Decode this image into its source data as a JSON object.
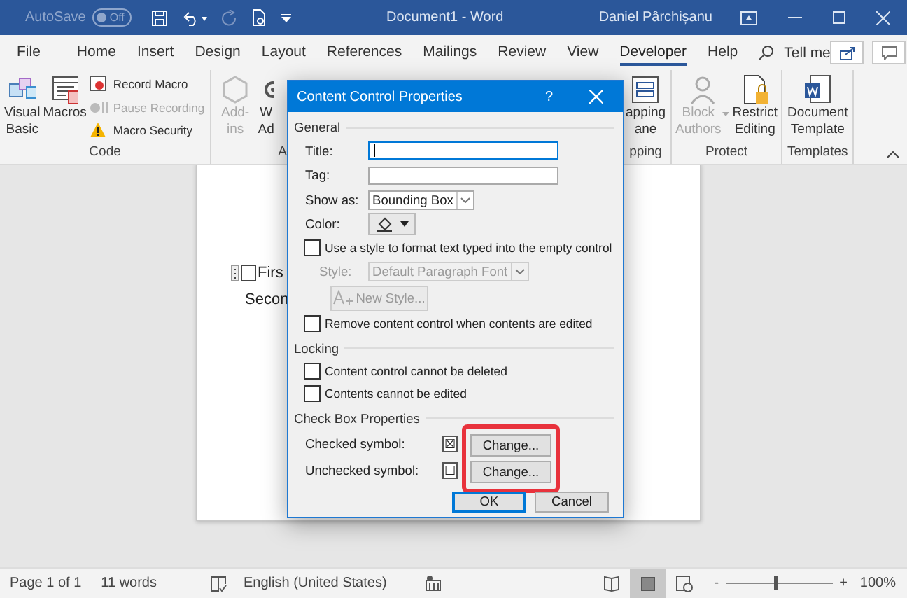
{
  "title_bar": {
    "autosave_label": "AutoSave",
    "autosave_state": "Off",
    "autosave_on": false,
    "document_title": "Document1  -  Word",
    "user_name": "Daniel Pârchișanu"
  },
  "tabs": [
    {
      "label": "File",
      "selected": false
    },
    {
      "label": "Home",
      "selected": false
    },
    {
      "label": "Insert",
      "selected": false
    },
    {
      "label": "Design",
      "selected": false
    },
    {
      "label": "Layout",
      "selected": false
    },
    {
      "label": "References",
      "selected": false
    },
    {
      "label": "Mailings",
      "selected": false
    },
    {
      "label": "Review",
      "selected": false
    },
    {
      "label": "View",
      "selected": false
    },
    {
      "label": "Developer",
      "selected": true
    },
    {
      "label": "Help",
      "selected": false
    }
  ],
  "tell_me": "Tell me",
  "ribbon": {
    "left_groups": [
      {
        "label": "Code",
        "items": [
          {
            "kind": "large",
            "label": "Visual Basic",
            "disabled": false
          },
          {
            "kind": "large",
            "label": "Macros",
            "disabled": false
          },
          {
            "kind": "small",
            "entries": [
              {
                "label": "Record Macro",
                "disabled": false
              },
              {
                "label": "Pause Recording",
                "disabled": true
              },
              {
                "label": "Macro Security",
                "disabled": false
              }
            ]
          }
        ]
      },
      {
        "label": "A",
        "items": [
          {
            "kind": "large",
            "label": "Add-ins",
            "disabled": true
          },
          {
            "kind": "large",
            "label": "W Ad",
            "disabled": false
          }
        ]
      }
    ],
    "right_groups": [
      {
        "label": "pping",
        "items": [
          {
            "kind": "large",
            "label": "apping ane",
            "disabled": false
          }
        ]
      },
      {
        "label": "Protect",
        "items": [
          {
            "kind": "large",
            "label": "Block Authors",
            "disabled": true,
            "dropdown": true
          },
          {
            "kind": "large",
            "label": "Restrict Editing",
            "disabled": false
          }
        ]
      },
      {
        "label": "Templates",
        "items": [
          {
            "kind": "large",
            "label": "Document Template",
            "disabled": false
          }
        ]
      }
    ]
  },
  "document": {
    "lines": [
      {
        "kind": "checkbox",
        "text": "Firs"
      },
      {
        "kind": "plain",
        "text": "Secon"
      }
    ]
  },
  "dialog": {
    "title": "Content Control Properties",
    "help": "?",
    "sections": [
      {
        "heading": "General",
        "rows": [
          {
            "kind": "text",
            "label": "Title:",
            "focused": true
          },
          {
            "kind": "text",
            "label": "Tag:",
            "focused": false
          },
          {
            "kind": "dropdown",
            "label": "Show as:",
            "value": "Bounding Box",
            "disabled": false
          },
          {
            "kind": "color",
            "label": "Color:"
          },
          {
            "kind": "checkbox",
            "label": "Use a style to format text typed into the empty control",
            "checked": false
          },
          {
            "kind": "dropdown",
            "label": "Style:",
            "value": "Default Paragraph Font",
            "disabled": true
          },
          {
            "kind": "button",
            "label": "New Style...",
            "disabled": true
          },
          {
            "kind": "checkbox",
            "label": "Remove content control when contents are edited",
            "checked": false
          }
        ]
      },
      {
        "heading": "Locking",
        "rows": [
          {
            "kind": "checkbox",
            "label": "Content control cannot be deleted",
            "checked": false
          },
          {
            "kind": "checkbox",
            "label": "Contents cannot be edited",
            "checked": false
          }
        ]
      },
      {
        "heading": "Check Box Properties",
        "rows": [
          {
            "kind": "symbol",
            "label": "Checked symbol:",
            "symbol": "☒",
            "button": "Change..."
          },
          {
            "kind": "symbol",
            "label": "Unchecked symbol:",
            "symbol": "☐",
            "button": "Change..."
          }
        ]
      }
    ],
    "buttons": [
      {
        "label": "OK",
        "default": true
      },
      {
        "label": "Cancel",
        "default": false
      }
    ],
    "highlight_symbol_buttons": true
  },
  "status_bar": {
    "page": "Page 1 of 1",
    "words": "11 words",
    "language": "English (United States)",
    "views": [
      {
        "kind": "read",
        "selected": false
      },
      {
        "kind": "print",
        "selected": true
      },
      {
        "kind": "web",
        "selected": false
      }
    ],
    "zoom": {
      "minus": "-",
      "plus": "+",
      "level": 0.47,
      "reading": "100%"
    }
  }
}
